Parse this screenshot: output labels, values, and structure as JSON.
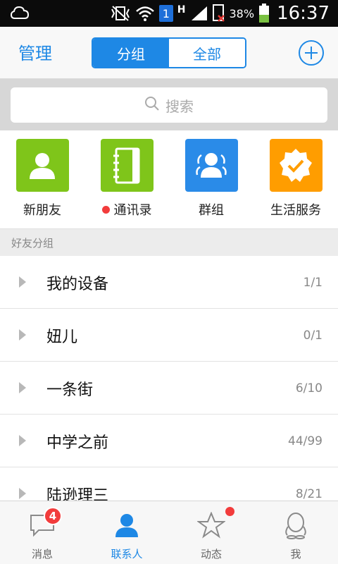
{
  "status_bar": {
    "sim_slot": "1",
    "network_type": "H",
    "battery_percent": "38%",
    "time": "16:37"
  },
  "header": {
    "manage_label": "管理",
    "segments": [
      "分组",
      "全部"
    ],
    "active_segment": "分组"
  },
  "search": {
    "placeholder": "搜索"
  },
  "quick_entries": [
    {
      "label": "新朋友",
      "icon": "new-friend-icon",
      "color": "#7fc51a",
      "dot": false
    },
    {
      "label": "通讯录",
      "icon": "address-book-icon",
      "color": "#7fc51a",
      "dot": true
    },
    {
      "label": "群组",
      "icon": "group-icon",
      "color": "#2a8be8",
      "dot": false
    },
    {
      "label": "生活服务",
      "icon": "life-service-icon",
      "color": "#ff9d00",
      "dot": false
    }
  ],
  "section": {
    "title": "好友分组"
  },
  "groups": [
    {
      "name": "我的设备",
      "count": "1/1"
    },
    {
      "name": "妞儿",
      "count": "0/1"
    },
    {
      "name": "一条街",
      "count": "6/10"
    },
    {
      "name": "中学之前",
      "count": "44/99"
    },
    {
      "name": "陆逊理三",
      "count": "8/21"
    }
  ],
  "tabs": [
    {
      "label": "消息",
      "icon": "message-icon",
      "badge": "4"
    },
    {
      "label": "联系人",
      "icon": "contacts-icon",
      "active": true
    },
    {
      "label": "动态",
      "icon": "star-icon",
      "dot": true
    },
    {
      "label": "我",
      "icon": "profile-icon"
    }
  ],
  "colors": {
    "accent": "#1e88e5",
    "badge": "#f23c3c"
  }
}
